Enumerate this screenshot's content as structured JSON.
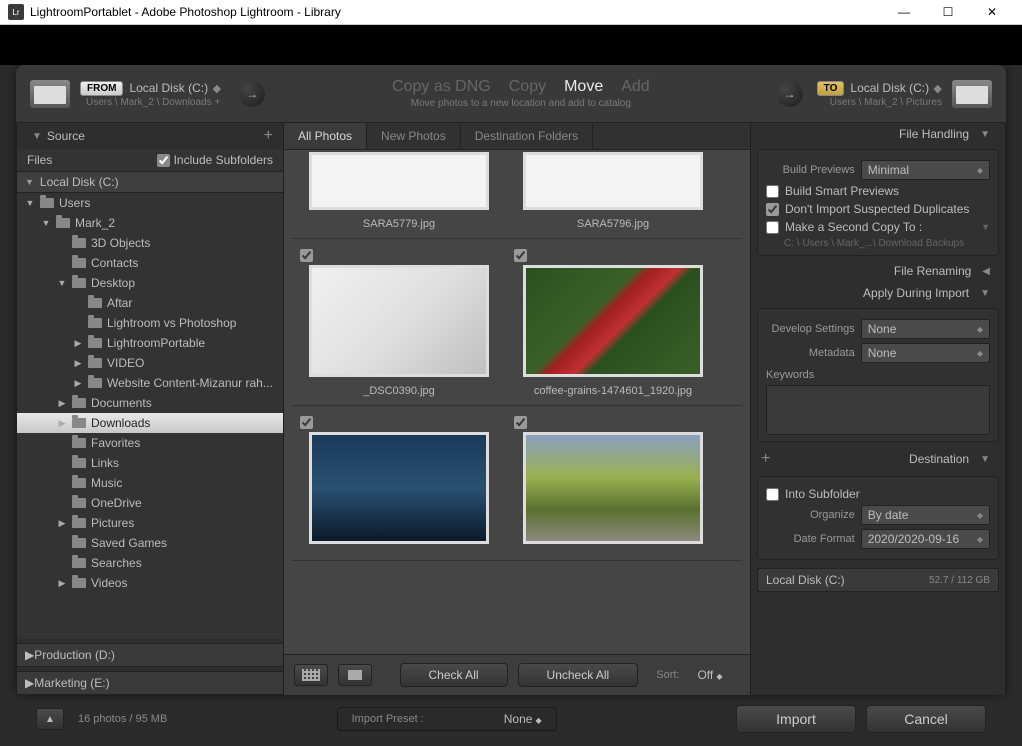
{
  "titlebar": {
    "app": "Lr",
    "title": "LightroomPortablet - Adobe Photoshop Lightroom - Library"
  },
  "from": {
    "badge": "FROM",
    "location": "Local Disk (C:)",
    "path": "Users \\ Mark_2 \\ Downloads +"
  },
  "to": {
    "badge": "TO",
    "location": "Local Disk (C:)",
    "path": "Users \\ Mark_2 \\ Pictures"
  },
  "actions": {
    "copy_dng": "Copy as DNG",
    "copy": "Copy",
    "move": "Move",
    "add": "Add",
    "subtitle": "Move photos to a new location and add to catalog"
  },
  "source": {
    "header": "Source",
    "files_label": "Files",
    "include_subfolders": "Include Subfolders",
    "drive": "Local Disk (C:)",
    "production": "Production (D:)",
    "marketing": "Marketing (E:)"
  },
  "tree": [
    {
      "label": "Users",
      "depth": 0,
      "expand": "▼"
    },
    {
      "label": "Mark_2",
      "depth": 1,
      "expand": "▼"
    },
    {
      "label": "3D Objects",
      "depth": 2,
      "expand": ""
    },
    {
      "label": "Contacts",
      "depth": 2,
      "expand": ""
    },
    {
      "label": "Desktop",
      "depth": 2,
      "expand": "▼"
    },
    {
      "label": "Aftar",
      "depth": 3,
      "expand": ""
    },
    {
      "label": "Lightroom vs Photoshop",
      "depth": 3,
      "expand": ""
    },
    {
      "label": "LightroomPortable",
      "depth": 3,
      "expand": "▶"
    },
    {
      "label": "VIDEO",
      "depth": 3,
      "expand": "▶"
    },
    {
      "label": "Website Content-Mizanur rah...",
      "depth": 3,
      "expand": "▶"
    },
    {
      "label": "Documents",
      "depth": 2,
      "expand": "▶"
    },
    {
      "label": "Downloads",
      "depth": 2,
      "expand": "▶",
      "selected": true
    },
    {
      "label": "Favorites",
      "depth": 2,
      "expand": ""
    },
    {
      "label": "Links",
      "depth": 2,
      "expand": ""
    },
    {
      "label": "Music",
      "depth": 2,
      "expand": ""
    },
    {
      "label": "OneDrive",
      "depth": 2,
      "expand": ""
    },
    {
      "label": "Pictures",
      "depth": 2,
      "expand": "▶"
    },
    {
      "label": "Saved Games",
      "depth": 2,
      "expand": ""
    },
    {
      "label": "Searches",
      "depth": 2,
      "expand": ""
    },
    {
      "label": "Videos",
      "depth": 2,
      "expand": "▶"
    }
  ],
  "tabs": {
    "all": "All Photos",
    "new": "New Photos",
    "dest": "Destination Folders"
  },
  "photos": {
    "row0": [
      {
        "fn": "SARA5779.jpg",
        "cls": "partial"
      },
      {
        "fn": "SARA5796.jpg",
        "cls": "partial"
      }
    ],
    "row1": [
      {
        "fn": "_DSC0390.jpg",
        "cls": "t-usb"
      },
      {
        "fn": "coffee-grains-1474601_1920.jpg",
        "cls": "t-berries"
      }
    ],
    "row2": [
      {
        "fn": "",
        "cls": "t-island"
      },
      {
        "fn": "",
        "cls": "t-valley"
      }
    ]
  },
  "bottom": {
    "check_all": "Check All",
    "uncheck_all": "Uncheck All",
    "sort": "Sort:",
    "sort_val": "Off"
  },
  "file_handling": {
    "header": "File Handling",
    "build_previews": "Build Previews",
    "build_previews_val": "Minimal",
    "smart": "Build Smart Previews",
    "dup": "Don't Import Suspected Duplicates",
    "second": "Make a Second Copy To :",
    "second_path": "C: \\ Users \\ Mark_...\\ Download Backups"
  },
  "file_renaming": "File Renaming",
  "apply": {
    "header": "Apply During Import",
    "develop": "Develop Settings",
    "develop_val": "None",
    "metadata": "Metadata",
    "metadata_val": "None",
    "keywords": "Keywords"
  },
  "dest": {
    "header": "Destination",
    "into_sub": "Into Subfolder",
    "organize": "Organize",
    "organize_val": "By date",
    "date_format": "Date Format",
    "date_format_val": "2020/2020-09-16",
    "disk": "Local Disk (C:)",
    "usage": "52.7 / 112 GB"
  },
  "footer": {
    "info": "16 photos / 95 MB",
    "preset_label": "Import Preset :",
    "preset_val": "None",
    "import": "Import",
    "cancel": "Cancel"
  }
}
